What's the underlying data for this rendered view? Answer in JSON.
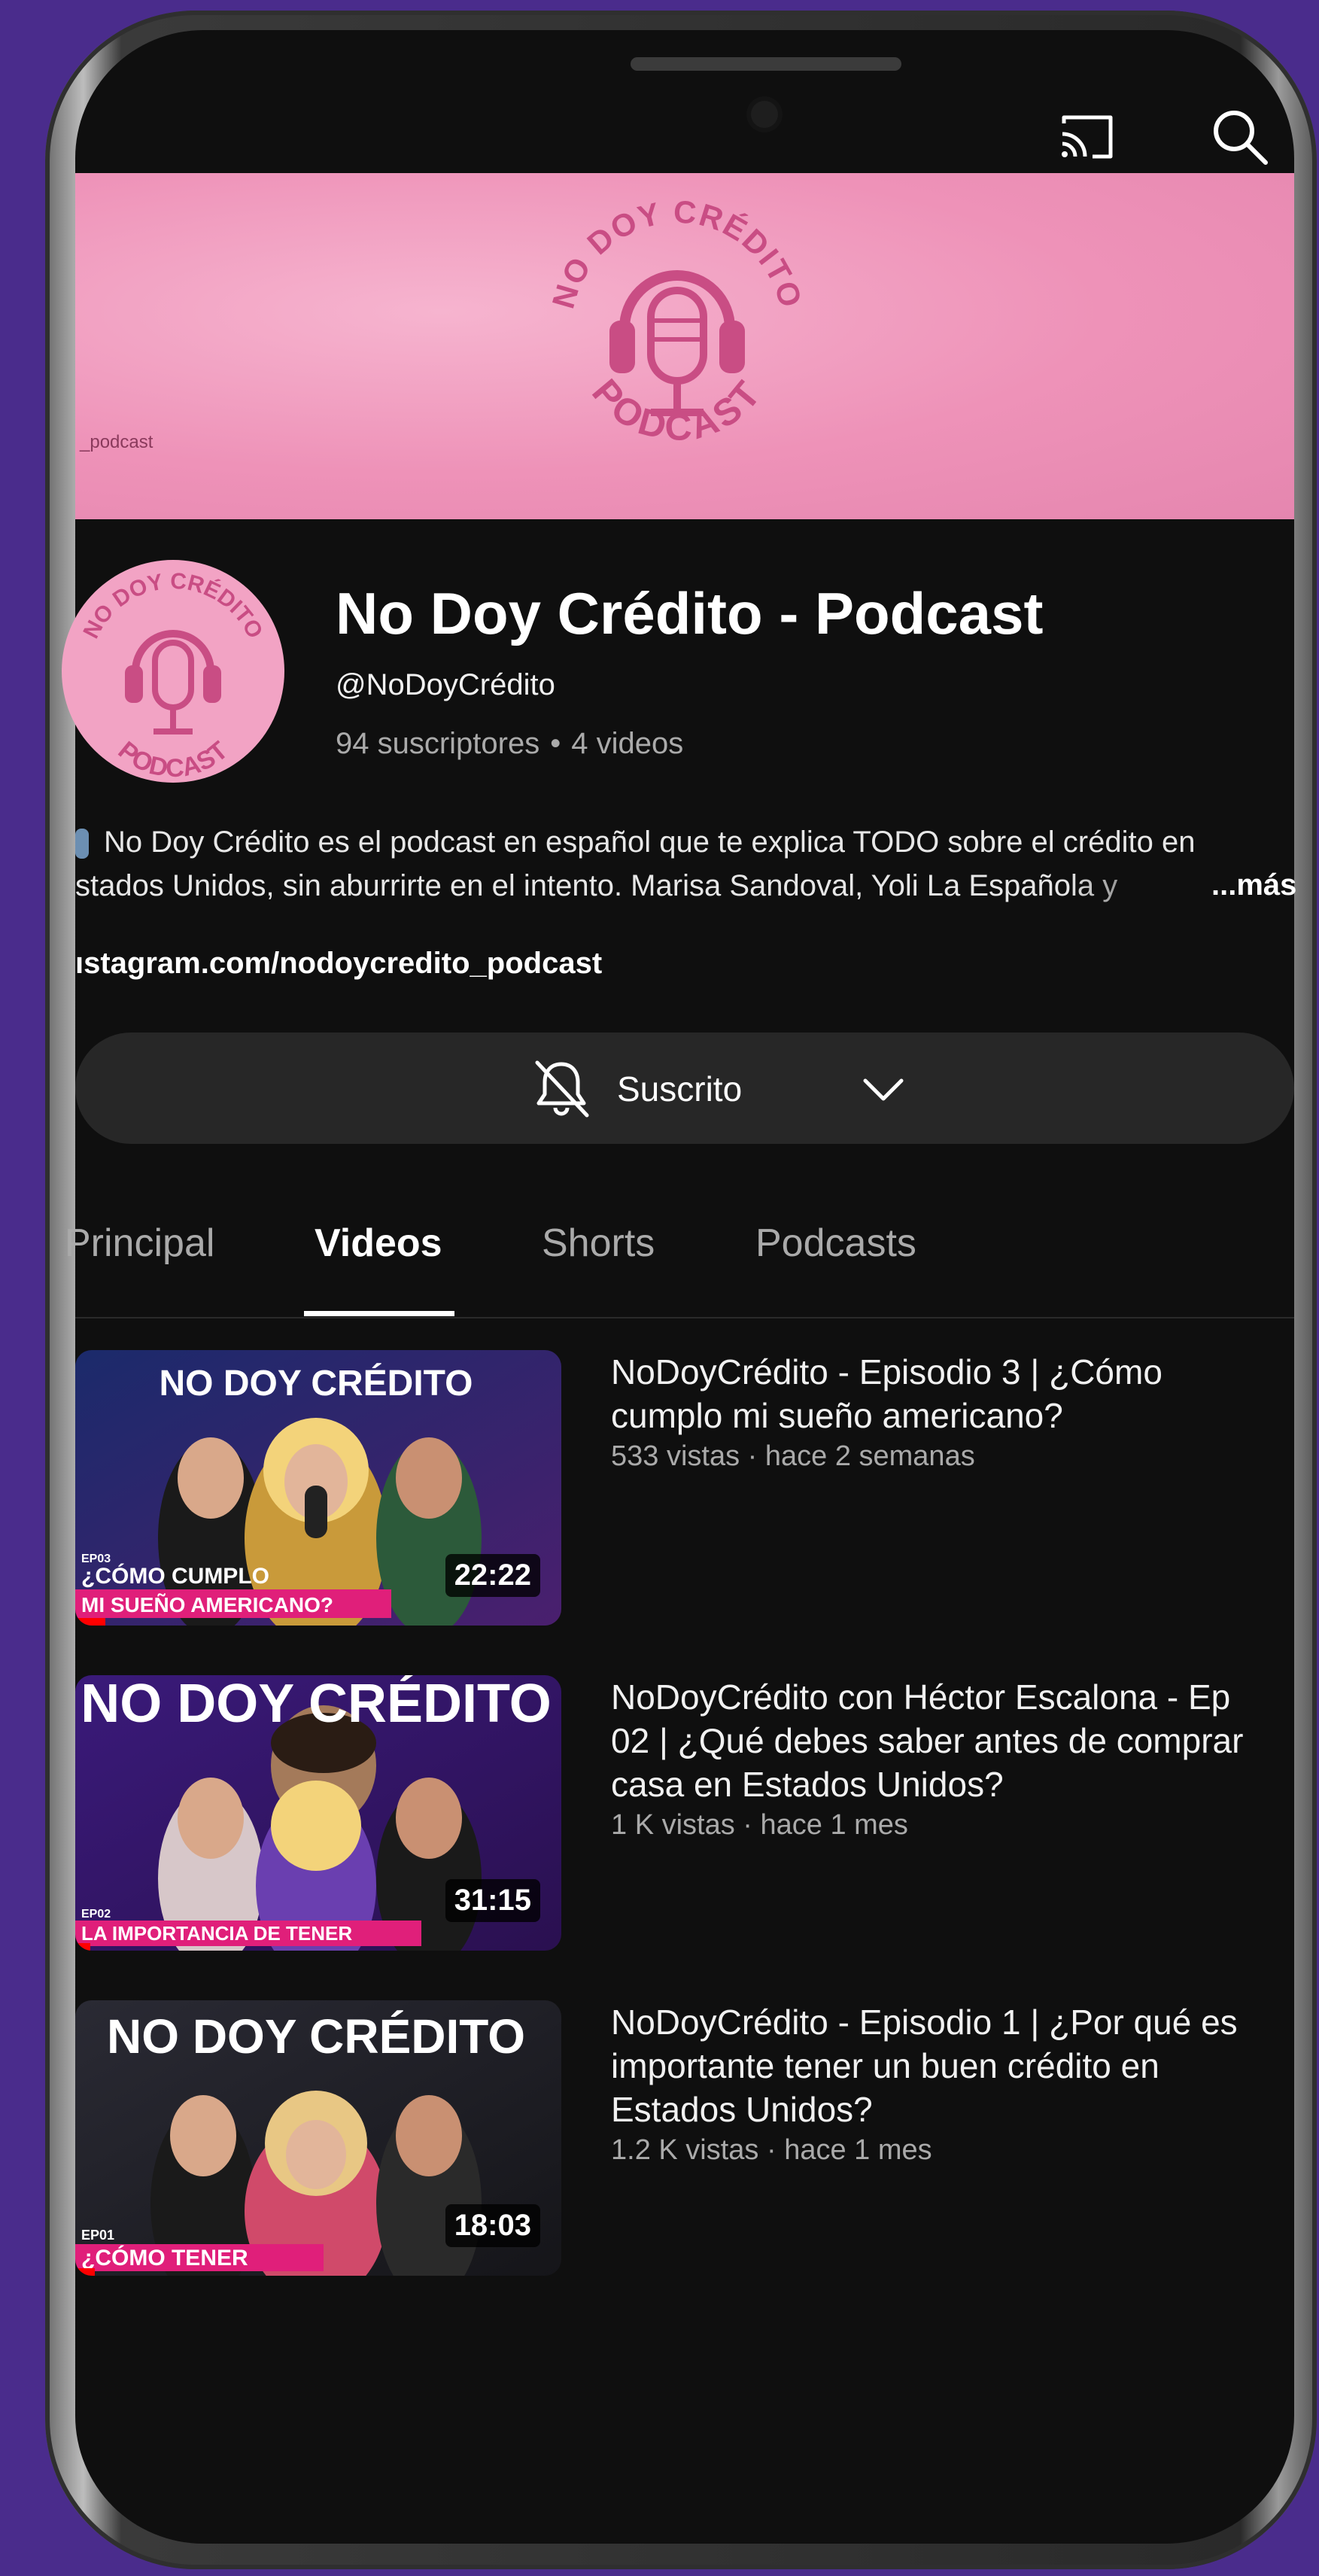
{
  "banner": {
    "logo_top_text": "NO DOY CRÉDITO",
    "logo_bottom_text": "PODCAST",
    "side_text": "_podcast",
    "bg_color": "#ee92b8"
  },
  "channel": {
    "name": "No Doy Crédito - Podcast",
    "handle": "@NoDoyCrédito",
    "subscribers": "94 suscriptores",
    "stats_separator": "•",
    "video_count": "4 videos",
    "description_line1": "No Doy Crédito es el podcast en español que te explica TODO sobre el crédito en",
    "description_line2": "stados Unidos, sin aburrirte en el intento. Marisa Sandoval, Yoli La Española y",
    "more_label": "...más",
    "link": "ıstagram.com/nodoycredito_podcast"
  },
  "subscribe": {
    "label": "Suscrito"
  },
  "tabs": [
    {
      "label": "Principal"
    },
    {
      "label": "Videos"
    },
    {
      "label": "Shorts"
    },
    {
      "label": "Podcasts"
    }
  ],
  "videos": [
    {
      "title": "NoDoyCrédito - Episodio 3 | ¿Cómo cumplo mi sueño americano?",
      "meta": "533 vistas · hace 2 semanas",
      "duration": "22:22",
      "thumb_banner": "NO DOY CRÉDITO",
      "thumb_ep": "EP03",
      "thumb_caption1": "¿CÓMO CUMPLO",
      "thumb_caption2": "MI SUEÑO AMERICANO?",
      "watched_fraction": 0.06
    },
    {
      "title": "NoDoyCrédito con Héctor Escalona - Ep 02 | ¿Qué debes saber antes de comprar casa en Estados Unidos?",
      "meta": "1 K vistas · hace 1 mes",
      "duration": "31:15",
      "thumb_banner": "NO DOY CRÉDITO",
      "thumb_ep": "EP02",
      "thumb_caption1": "LA IMPORTANCIA DE TENER",
      "thumb_caption2": "",
      "watched_fraction": 0.03
    },
    {
      "title": "NoDoyCrédito - Episodio 1 | ¿Por qué es importante tener un buen crédito en Estados Unidos?",
      "meta": "1.2 K vistas · hace 1 mes",
      "duration": "18:03",
      "thumb_banner": "NO DOY CRÉDITO",
      "thumb_ep": "EP01",
      "thumb_caption1": "¿CÓMO TENER",
      "thumb_caption2": "",
      "watched_fraction": 0.04
    }
  ],
  "colors": {
    "background": "#4a2c8c",
    "screen": "#0f0f0f",
    "pink": "#f2a3c4",
    "accent_red": "#ff0000"
  }
}
